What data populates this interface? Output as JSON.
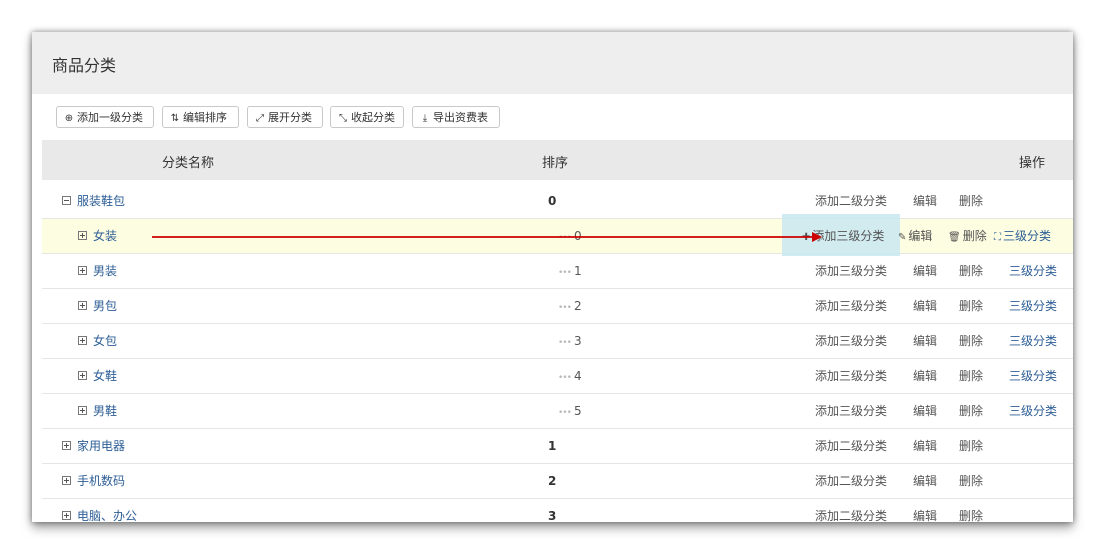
{
  "panel": {
    "title": "商品分类"
  },
  "toolbar": {
    "buttons": [
      {
        "icon": "add-circle-icon",
        "glyph": "⊕",
        "label": "添加一级分类"
      },
      {
        "icon": "sort-icon",
        "glyph": "⇅",
        "label": "编辑排序"
      },
      {
        "icon": "expand-icon",
        "glyph": "⤢",
        "label": "展开分类"
      },
      {
        "icon": "collapse-icon",
        "glyph": "⤡",
        "label": "收起分类"
      },
      {
        "icon": "download-icon",
        "glyph": "⤓",
        "label": "导出资费表"
      }
    ]
  },
  "table": {
    "headers": {
      "name": "分类名称",
      "sort": "排序",
      "ops": "操作"
    },
    "rows": [
      {
        "name": "服装鞋包",
        "sort": "0",
        "level": 1,
        "expanded": true,
        "ops": [
          "添加二级分类",
          "编辑",
          "删除"
        ]
      },
      {
        "name": "女装",
        "sort": "0",
        "level": 2,
        "highlight": true,
        "ops": [
          "添加三级分类",
          "编辑",
          "删除",
          "三级分类"
        ]
      },
      {
        "name": "男装",
        "sort": "1",
        "level": 2,
        "ops": [
          "添加三级分类",
          "编辑",
          "删除",
          "三级分类"
        ]
      },
      {
        "name": "男包",
        "sort": "2",
        "level": 2,
        "ops": [
          "添加三级分类",
          "编辑",
          "删除",
          "三级分类"
        ]
      },
      {
        "name": "女包",
        "sort": "3",
        "level": 2,
        "ops": [
          "添加三级分类",
          "编辑",
          "删除",
          "三级分类"
        ]
      },
      {
        "name": "女鞋",
        "sort": "4",
        "level": 2,
        "ops": [
          "添加三级分类",
          "编辑",
          "删除",
          "三级分类"
        ]
      },
      {
        "name": "男鞋",
        "sort": "5",
        "level": 2,
        "ops": [
          "添加三级分类",
          "编辑",
          "删除",
          "三级分类"
        ]
      },
      {
        "name": "家用电器",
        "sort": "1",
        "level": 1,
        "ops": [
          "添加二级分类",
          "编辑",
          "删除"
        ]
      },
      {
        "name": "手机数码",
        "sort": "2",
        "level": 1,
        "ops": [
          "添加二级分类",
          "编辑",
          "删除"
        ]
      },
      {
        "name": "电脑、办公",
        "sort": "3",
        "level": 1,
        "ops": [
          "添加二级分类",
          "编辑",
          "删除"
        ]
      }
    ]
  },
  "colors": {
    "link": "#2d5e96",
    "highlight_row": "#fdfde1",
    "annotation_arrow": "#cc0000"
  }
}
